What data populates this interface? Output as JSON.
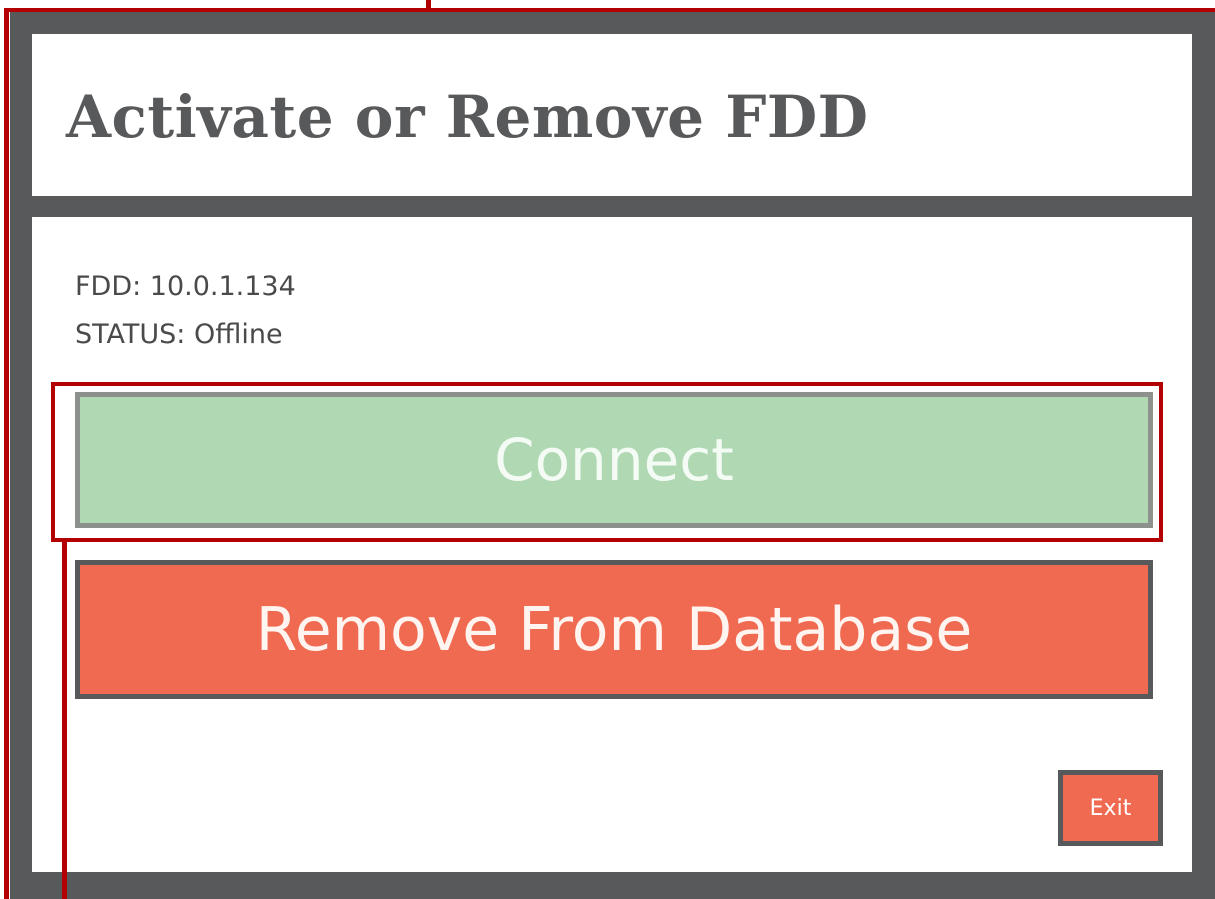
{
  "dialog": {
    "title": "Activate or Remove FDD",
    "info": {
      "fdd_line": "FDD: 10.0.1.134",
      "status_line": "STATUS: Offline"
    },
    "buttons": {
      "connect_label": "Connect",
      "remove_label": "Remove From Database",
      "exit_label": "Exit"
    }
  },
  "colors": {
    "frame": "#58595b",
    "panel": "#ffffff",
    "title_text": "#58595b",
    "connect_bg": "#afd8b3",
    "connect_text": "#f4fbf5",
    "remove_bg": "#ef6a51",
    "remove_text": "#fff4ef",
    "exit_bg": "#ef6a51",
    "exit_text": "#ffffff",
    "annotation": "#b30000"
  }
}
